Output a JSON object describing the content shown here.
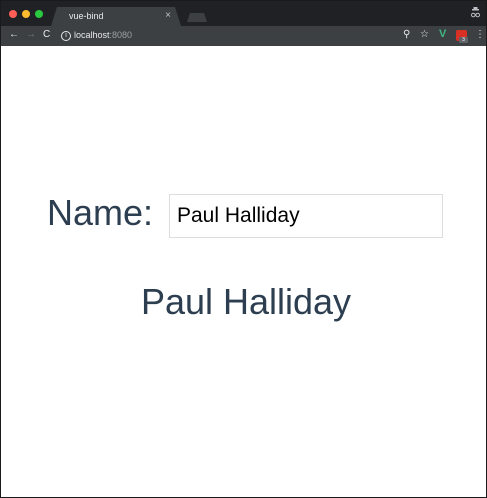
{
  "browser": {
    "tab_title": "vue-bind",
    "tab_close": "×",
    "url_host": "localhost",
    "url_port": ":8080",
    "nav": {
      "back": "←",
      "forward": "→",
      "reload": "C"
    },
    "icons": {
      "info": "i",
      "zoom": "⚲",
      "star": "☆",
      "vue": "V",
      "ext_badge": "3",
      "kebab": "⋮",
      "window": "⌕"
    }
  },
  "form": {
    "label": "Name:",
    "value": "Paul Halliday"
  },
  "output": {
    "text": "Paul Halliday"
  },
  "colors": {
    "text": "#2c3e50",
    "vue_green": "#41b883"
  }
}
